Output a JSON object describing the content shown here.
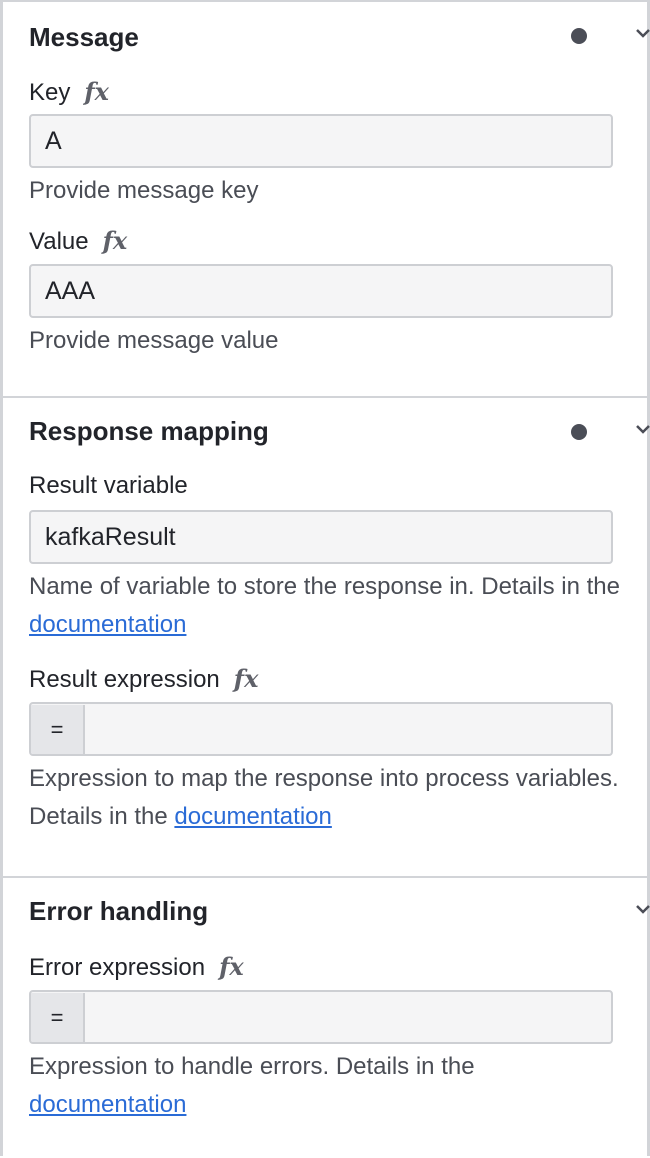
{
  "message": {
    "title": "Message",
    "key_label": "Key",
    "key_value": "A",
    "key_description": "Provide message key",
    "value_label": "Value",
    "value_value": "AAA",
    "value_description": "Provide message value"
  },
  "response_mapping": {
    "title": "Response mapping",
    "result_variable_label": "Result variable",
    "result_variable_value": "kafkaResult",
    "result_variable_desc_prefix": "Name of variable to store the response in. Details in the ",
    "result_variable_link": "documentation",
    "result_expression_label": "Result expression",
    "result_expression_prefix": "=",
    "result_expression_value": "",
    "result_expression_desc_prefix": "Expression to map the response into process variables. Details in the ",
    "result_expression_link": "documentation"
  },
  "error_handling": {
    "title": "Error handling",
    "error_expression_label": "Error expression",
    "error_expression_prefix": "=",
    "error_expression_value": "",
    "error_expression_desc_prefix": "Expression to handle errors. Details in the ",
    "error_expression_link": "documentation"
  },
  "fx_symbol": "fx",
  "colors": {
    "link": "#2a6bd6",
    "border": "#d2d4d8",
    "input_bg": "#f5f5f6",
    "dot": "#4b4e57"
  },
  "icons": {
    "status_dot": "filled-circle",
    "collapse": "chevron-down-icon",
    "feel": "fx-icon"
  }
}
